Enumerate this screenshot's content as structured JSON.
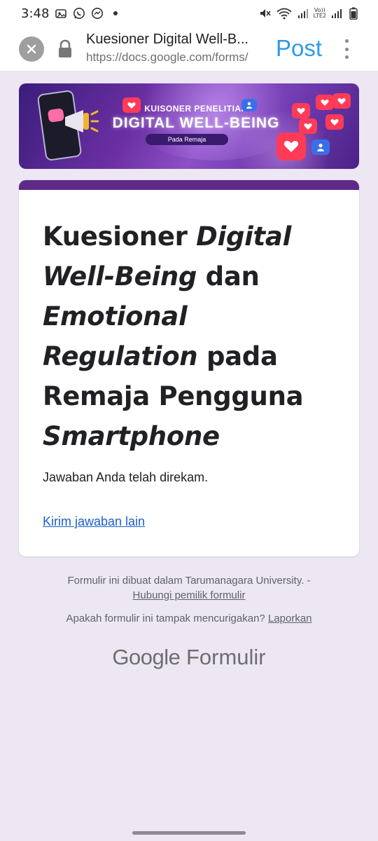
{
  "status_bar": {
    "time": "3:48",
    "volte_label_top": "Vo))",
    "volte_label_bottom": "LTE2"
  },
  "browser": {
    "page_title": "Kuesioner Digital Well-B...",
    "url": "https://docs.google.com/forms/",
    "post_label": "Post"
  },
  "banner": {
    "subtitle": "KUISONER PENELITIAN",
    "title": "DIGITAL WELL-BEING",
    "pill": "Pada Remaja"
  },
  "form": {
    "title_parts": [
      {
        "text": "Kuesioner ",
        "italic": false
      },
      {
        "text": "Digital Well-Being",
        "italic": true
      },
      {
        "text": " dan ",
        "italic": false
      },
      {
        "text": "Emotional Regulation",
        "italic": true
      },
      {
        "text": " pada Remaja Pengguna ",
        "italic": false
      },
      {
        "text": "Smartphone",
        "italic": true
      }
    ],
    "response_message": "Jawaban Anda telah direkam.",
    "another_response_link": "Kirim jawaban lain"
  },
  "footer": {
    "created_in": "Formulir ini dibuat dalam Tarumanagara University. -",
    "contact_owner_link": "Hubungi pemilik formulir",
    "suspicious_question": "Apakah formulir ini tampak mencurigakan?",
    "report_link": "Laporkan",
    "logo_google": "Google",
    "logo_product": "Formulir"
  },
  "colors": {
    "accent": "#5f2a87",
    "link": "#1a5fcb",
    "post": "#2d9be9",
    "background": "#ece7f3"
  }
}
